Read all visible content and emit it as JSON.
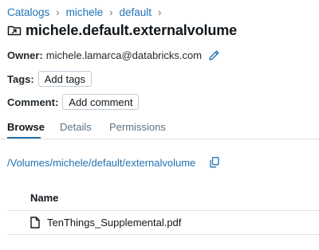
{
  "breadcrumb": {
    "items": [
      "Catalogs",
      "michele",
      "default"
    ],
    "separator": "›"
  },
  "title": {
    "text": "michele.default.externalvolume",
    "icon": "external-volume-icon"
  },
  "owner": {
    "label": "Owner:",
    "value": "michele.lamarca@databricks.com",
    "edit_icon": "pencil-icon"
  },
  "tags": {
    "label": "Tags:",
    "button": "Add tags"
  },
  "comment": {
    "label": "Comment:",
    "button": "Add comment"
  },
  "tabs": [
    {
      "label": "Browse",
      "active": true
    },
    {
      "label": "Details",
      "active": false
    },
    {
      "label": "Permissions",
      "active": false
    }
  ],
  "path": {
    "text": "/Volumes/michele/default/externalvolume",
    "copy_icon": "copy-icon"
  },
  "table": {
    "columns": [
      "Name"
    ],
    "rows": [
      {
        "name": "TenThings_Supplemental.pdf",
        "icon": "file-icon"
      }
    ]
  },
  "colors": {
    "link": "#2272b4",
    "text": "#11171c",
    "muted": "#5f7281",
    "border": "#e0e0e0"
  }
}
